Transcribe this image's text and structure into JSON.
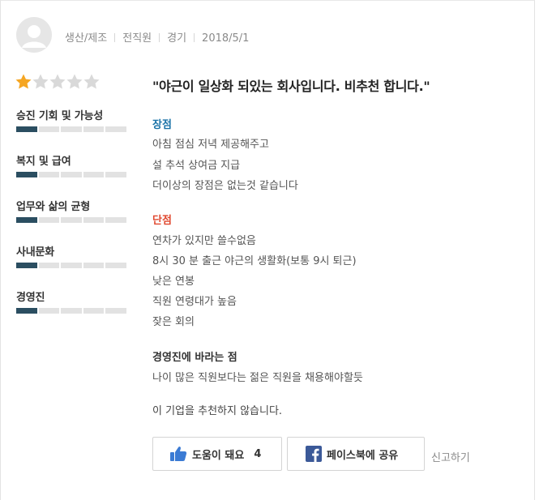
{
  "author": {
    "job_category": "생산/제조",
    "employment_status": "전직원",
    "location": "경기",
    "date": "2018/5/1"
  },
  "rating": {
    "overall_stars": 1,
    "max_stars": 5,
    "star_filled_color": "#f5a623",
    "star_empty_color": "#d9d9d9",
    "categories": [
      {
        "label": "승진 기회 및 가능성",
        "score": 1,
        "max": 5
      },
      {
        "label": "복지 및 급여",
        "score": 1,
        "max": 5
      },
      {
        "label": "업무와 삶의 균형",
        "score": 1,
        "max": 5
      },
      {
        "label": "사내문화",
        "score": 1,
        "max": 5
      },
      {
        "label": "경영진",
        "score": 1,
        "max": 5
      }
    ],
    "bar_color": "#2b4e61"
  },
  "review": {
    "title": "\"야근이 일상화 되있는 회사입니다. 비추천 합니다.\"",
    "pros_heading": "장점",
    "pros": [
      "아침 점심 저녁 제공해주고",
      "설 추석 상여금 지급",
      "더이상의 장점은 없는것 같습니다"
    ],
    "cons_heading": "단점",
    "cons": [
      "연차가 있지만 쓸수없음",
      "8시 30 분 출근 야근의 생활화(보통 9시 퇴근)",
      "낮은 연봉",
      "직원 연령대가 높음",
      "잦은 회의"
    ],
    "wish_heading": "경영진에 바라는 점",
    "wish": "나이 많은 직원보다는 젊은 직원을 채용해야할듯",
    "recommendation": "이 기업을 추천하지 않습니다."
  },
  "actions": {
    "helpful_label": "도움이 돼요",
    "helpful_count": "4",
    "facebook_label": "페이스북에 공유",
    "report_label": "신고하기",
    "helpful_icon": "thumbs-up-icon",
    "facebook_icon": "facebook-icon"
  }
}
